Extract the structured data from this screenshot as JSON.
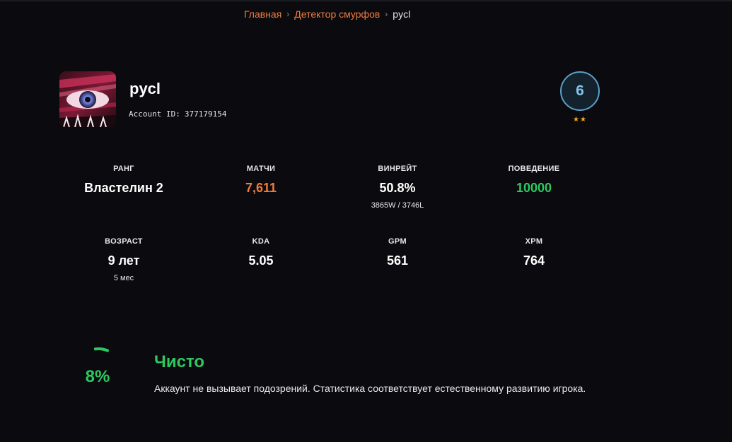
{
  "breadcrumb": {
    "home": "Главная",
    "section": "Детектор смурфов",
    "current": "pycl"
  },
  "player": {
    "name": "pycl",
    "account_id_label": "Account ID:",
    "account_id": "377179154",
    "rank_badge": {
      "number": "6",
      "stars": "★★"
    }
  },
  "stats": [
    {
      "label": "РАНГ",
      "value": "Властелин 2",
      "sub": ""
    },
    {
      "label": "МАТЧИ",
      "value": "7,611",
      "sub": ""
    },
    {
      "label": "ВИНРЕЙТ",
      "value": "50.8%",
      "sub": "3865W / 3746L"
    },
    {
      "label": "ПОВЕДЕНИЕ",
      "value": "10000",
      "sub": ""
    },
    {
      "label": "ВОЗРАСТ",
      "value": "9 лет",
      "sub": "5 мес"
    },
    {
      "label": "KDA",
      "value": "5.05",
      "sub": ""
    },
    {
      "label": "GPM",
      "value": "561",
      "sub": ""
    },
    {
      "label": "XPM",
      "value": "764",
      "sub": ""
    }
  ],
  "verdict": {
    "percent": "8%",
    "gauge_fraction": 0.08,
    "title": "Чисто",
    "description": "Аккаунт не вызывает подозрений. Статистика соответствует естественному развитию игрока."
  },
  "colors": {
    "background": "#0b0b0f",
    "accent_orange": "#f07a3c",
    "accent_green": "#2dc860",
    "badge_blue": "#5b9fc9",
    "star": "#f5a623"
  }
}
